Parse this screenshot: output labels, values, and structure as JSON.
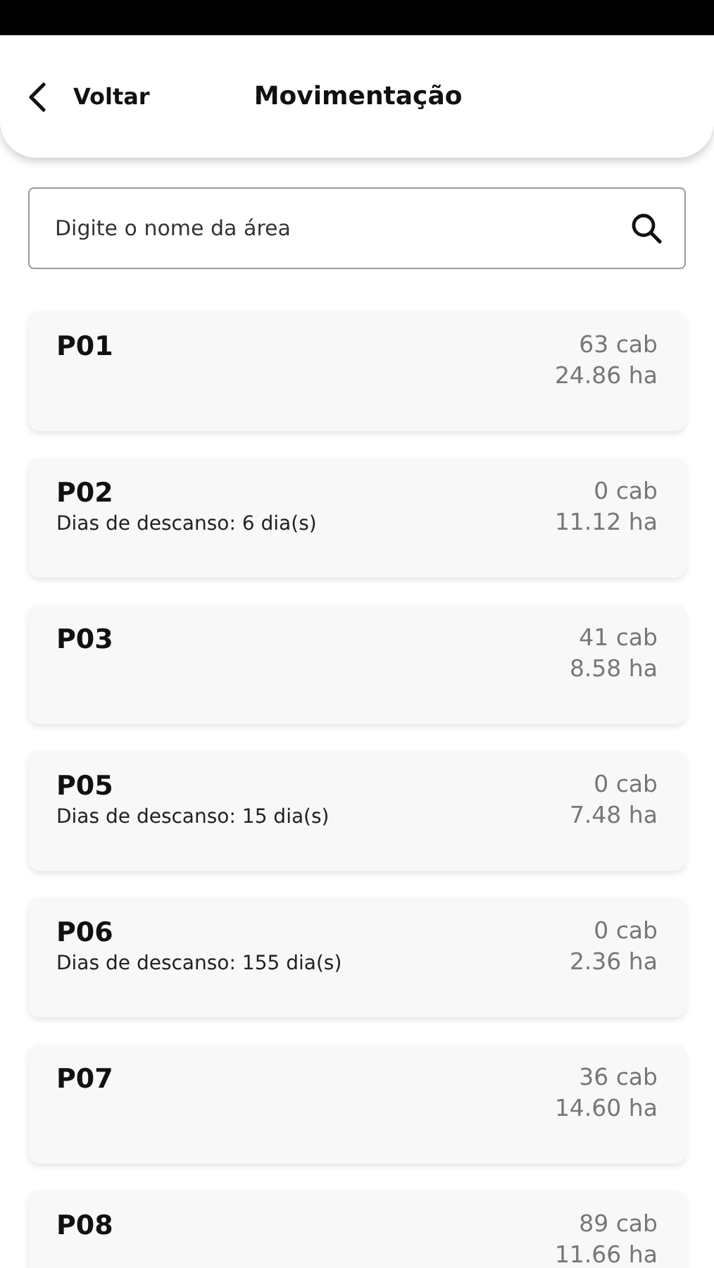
{
  "header": {
    "back_label": "Voltar",
    "title": "Movimentação"
  },
  "search": {
    "placeholder": "Digite o nome da área"
  },
  "areas": [
    {
      "name": "P01",
      "heads": "63 cab",
      "size": "24.86 ha"
    },
    {
      "name": "P02",
      "rest": "Dias de descanso: 6 dia(s)",
      "heads": "0 cab",
      "size": "11.12 ha"
    },
    {
      "name": "P03",
      "heads": "41 cab",
      "size": "8.58 ha"
    },
    {
      "name": "P05",
      "rest": "Dias de descanso: 15 dia(s)",
      "heads": "0 cab",
      "size": "7.48 ha"
    },
    {
      "name": "P06",
      "rest": "Dias de descanso: 155 dia(s)",
      "heads": "0 cab",
      "size": "2.36 ha"
    },
    {
      "name": "P07",
      "heads": "36 cab",
      "size": "14.60 ha"
    },
    {
      "name": "P08",
      "heads": "89 cab",
      "size": "11.66 ha"
    }
  ]
}
